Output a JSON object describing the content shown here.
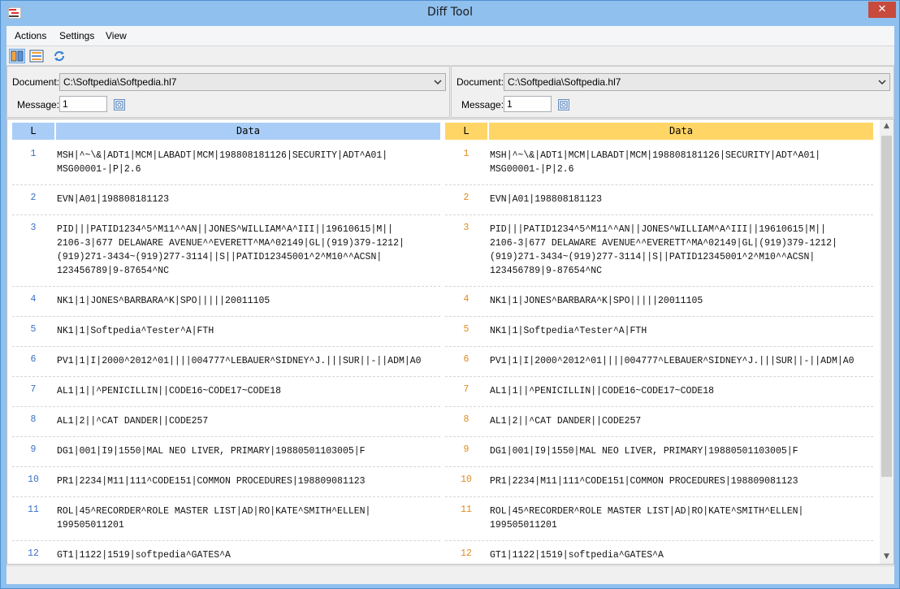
{
  "window": {
    "title": "Diff Tool",
    "close_glyph": "✕"
  },
  "menu": [
    "Actions",
    "Settings",
    "View"
  ],
  "toolbar": {
    "icons": [
      "side-by-side-view-icon",
      "inline-view-icon",
      "refresh-icon"
    ]
  },
  "left": {
    "document_label": "Document:",
    "document_value": "C:\\Softpedia\\Softpedia.hl7",
    "message_label": "Message:",
    "message_value": "1",
    "header_color": "#a9cdf7",
    "number_color": "#3a6fc4"
  },
  "right": {
    "document_label": "Document:",
    "document_value": "C:\\Softpedia\\Softpedia.hl7",
    "message_label": "Message:",
    "message_value": "1",
    "header_color": "#ffd566",
    "number_color": "#e08b1d"
  },
  "grid": {
    "col_line": "L",
    "col_data": "Data",
    "rows": [
      {
        "n": "1",
        "text": "MSH|^~\\&|ADT1|MCM|LABADT|MCM|198808181126|SECURITY|ADT^A01|\nMSG00001-|P|2.6"
      },
      {
        "n": "2",
        "text": "EVN|A01|198808181123"
      },
      {
        "n": "3",
        "text": "PID|||PATID1234^5^M11^^AN||JONES^WILLIAM^A^III||19610615|M||\n2106-3|677 DELAWARE AVENUE^^EVERETT^MA^02149|GL|(919)379-1212|\n(919)271-3434~(919)277-3114||S||PATID12345001^2^M10^^ACSN|\n123456789|9-87654^NC"
      },
      {
        "n": "4",
        "text": "NK1|1|JONES^BARBARA^K|SPO|||||20011105"
      },
      {
        "n": "5",
        "text": "NK1|1|Softpedia^Tester^A|FTH"
      },
      {
        "n": "6",
        "text": "PV1|1|I|2000^2012^01||||004777^LEBAUER^SIDNEY^J.|||SUR||-||ADM|A0"
      },
      {
        "n": "7",
        "text": "AL1|1||^PENICILLIN||CODE16~CODE17~CODE18"
      },
      {
        "n": "8",
        "text": "AL1|2||^CAT DANDER||CODE257"
      },
      {
        "n": "9",
        "text": "DG1|001|I9|1550|MAL NEO LIVER, PRIMARY|19880501103005|F"
      },
      {
        "n": "10",
        "text": "PR1|2234|M11|111^CODE151|COMMON PROCEDURES|198809081123"
      },
      {
        "n": "11",
        "text": "ROL|45^RECORDER^ROLE MASTER LIST|AD|RO|KATE^SMITH^ELLEN|\n199505011201"
      },
      {
        "n": "12",
        "text": "GT1|1122|1519|softpedia^GATES^A"
      }
    ]
  }
}
